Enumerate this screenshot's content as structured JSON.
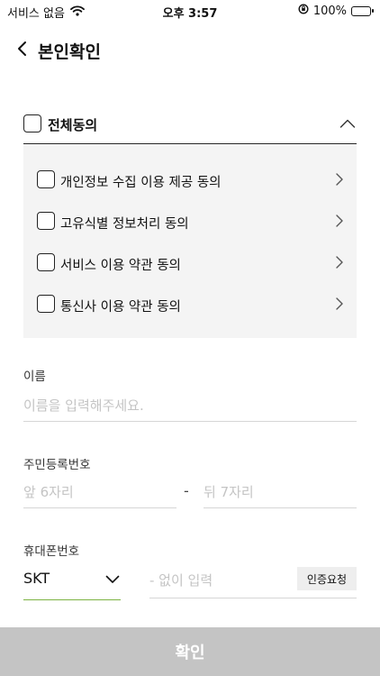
{
  "status_bar": {
    "carrier": "서비스 없음",
    "time": "오후 3:57",
    "battery": "100%",
    "battery_level": 1.0
  },
  "header": {
    "title": "본인확인"
  },
  "agreements": {
    "all_label": "전체동의",
    "items": [
      {
        "label": "개인정보 수집 이용 제공 동의"
      },
      {
        "label": "고유식별 정보처리 동의"
      },
      {
        "label": "서비스 이용 약관 동의"
      },
      {
        "label": "통신사 이용 약관 동의"
      }
    ]
  },
  "form": {
    "name": {
      "label": "이름",
      "placeholder": "이름을 입력해주세요."
    },
    "resident_number": {
      "label": "주민등록번호",
      "front_placeholder": "앞 6자리",
      "separator": "-",
      "back_placeholder": "뒤 7자리"
    },
    "phone": {
      "label": "휴대폰번호",
      "carrier": "SKT",
      "placeholder": "- 없이 입력",
      "verify_label": "인증요청"
    }
  },
  "confirm_label": "확인",
  "colors": {
    "accent_underline": "#7cb342",
    "confirm_disabled": "#c4c4c4",
    "panel_bg": "#f4f4f4",
    "battery": "#32c45a"
  }
}
